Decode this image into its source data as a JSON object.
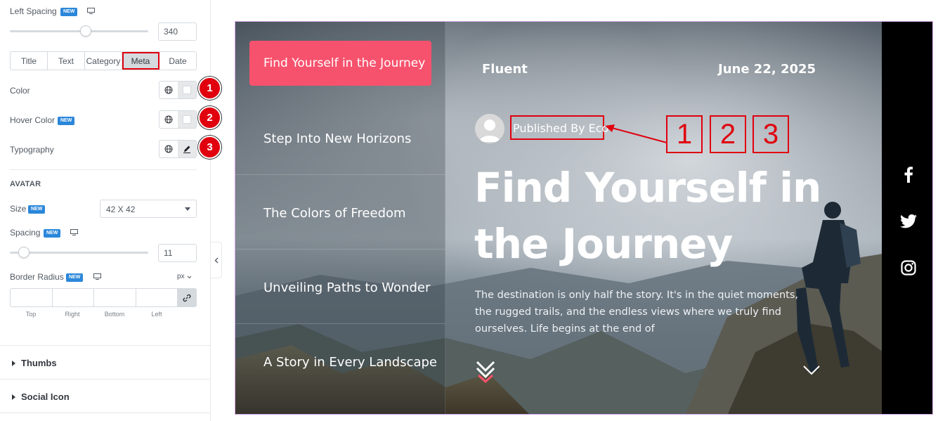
{
  "panel": {
    "left_spacing": {
      "label": "Left Spacing",
      "badge": "NEW",
      "value": "340",
      "slider_fraction": 0.55
    },
    "tabs": [
      {
        "label": "Title",
        "active": false
      },
      {
        "label": "Text",
        "active": false
      },
      {
        "label": "Category",
        "active": false
      },
      {
        "label": "Meta",
        "active": true
      },
      {
        "label": "Date",
        "active": false
      }
    ],
    "color": {
      "label": "Color",
      "marker": "1"
    },
    "hover_color": {
      "label": "Hover Color",
      "badge": "NEW",
      "marker": "2"
    },
    "typography": {
      "label": "Typography",
      "marker": "3"
    },
    "avatar_section": "AVATAR",
    "size": {
      "label": "Size",
      "badge": "NEW",
      "value": "42 X 42"
    },
    "spacing": {
      "label": "Spacing",
      "badge": "NEW",
      "value": "11",
      "slider_fraction": 0.1
    },
    "border_radius": {
      "label": "Border Radius",
      "badge": "NEW",
      "unit": "px",
      "fields": [
        "Top",
        "Right",
        "Bottom",
        "Left"
      ]
    },
    "accordions": [
      "Thumbs",
      "Social Icon"
    ]
  },
  "preview": {
    "nav": [
      "Find Yourself in the Journey",
      "Step Into New Horizons",
      "The Colors of Freedom",
      "Unveiling Paths to Wonder",
      "A Story in Every Landscape"
    ],
    "brand": "Fluent",
    "date": "June 22, 2025",
    "author": "Published By Eco",
    "title": "Find Yourself in the Journey",
    "excerpt": "The destination is only half the story. It's in the quiet moments, the rugged trails, and the endless views where we truly find ourselves. Life begins at the end of",
    "annotation_numbers": [
      "1",
      "2",
      "3"
    ],
    "social_icons": [
      "facebook-icon",
      "twitter-icon",
      "instagram-icon"
    ]
  },
  "colors": {
    "accent": "#f7526d",
    "annotation_red": "#e0000e",
    "editor_blue": "#2b87da"
  }
}
